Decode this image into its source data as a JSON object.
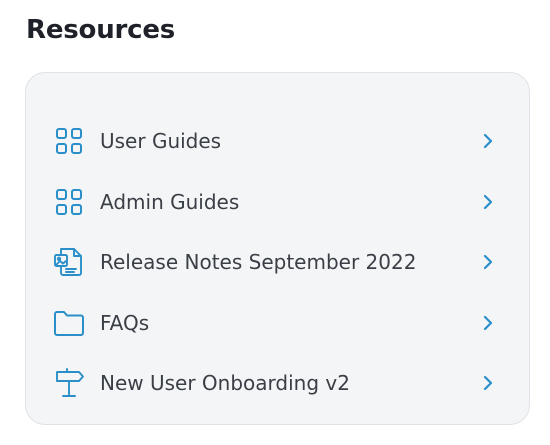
{
  "section": {
    "title": "Resources"
  },
  "colors": {
    "accent": "#2a8fc9",
    "panel_bg": "#f4f5f7",
    "panel_border": "#dfe2e6",
    "text": "#3a3f46"
  },
  "items": [
    {
      "label": "User Guides",
      "icon": "grid-icon"
    },
    {
      "label": "Admin Guides",
      "icon": "grid-icon"
    },
    {
      "label": "Release Notes September 2022",
      "icon": "document-image-icon"
    },
    {
      "label": "FAQs",
      "icon": "folder-icon"
    },
    {
      "label": "New User Onboarding v2",
      "icon": "signpost-icon"
    }
  ]
}
